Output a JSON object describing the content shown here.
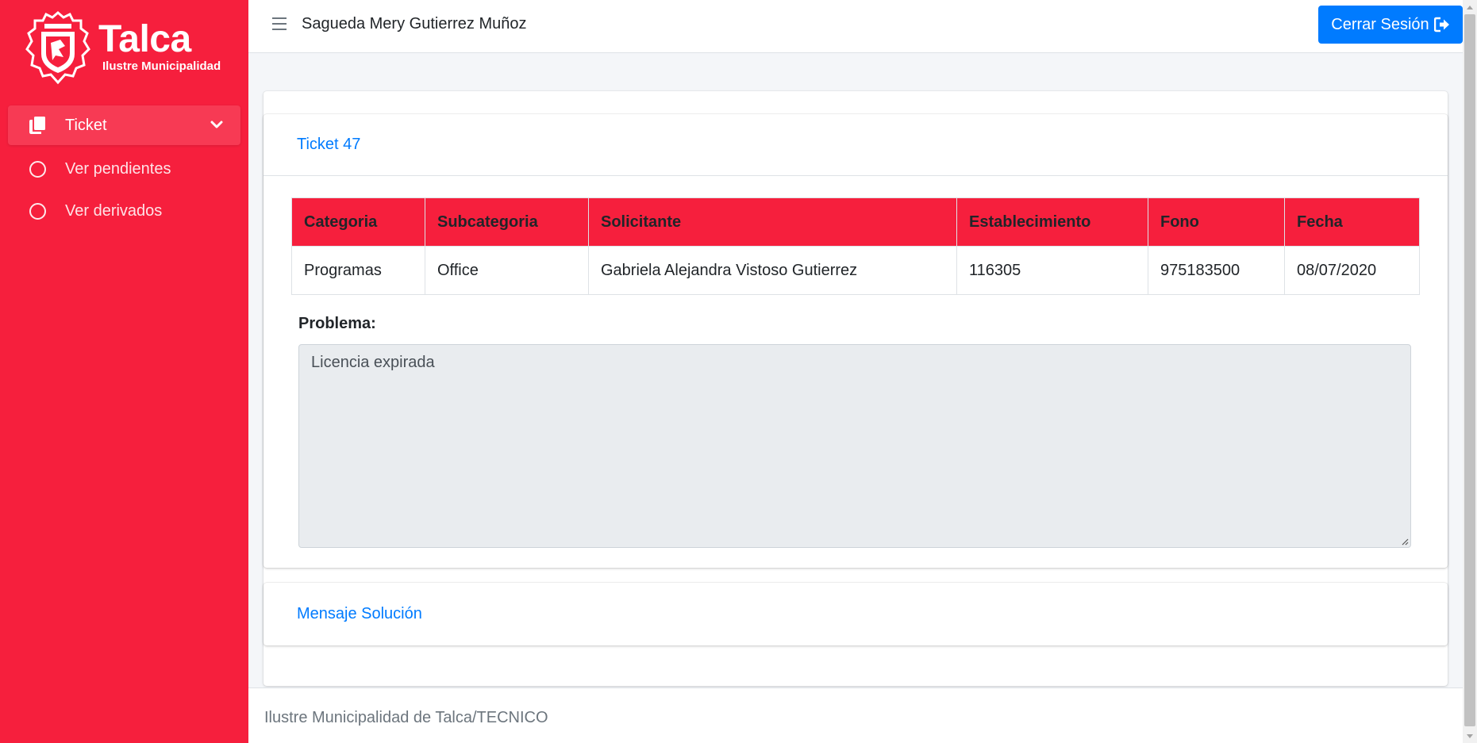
{
  "brand": {
    "name": "Talca",
    "subtitle": "Ilustre Municipalidad"
  },
  "sidebar": {
    "menu": {
      "label": "Ticket",
      "icon": "copy-icon"
    },
    "items": [
      {
        "label": "Ver pendientes",
        "icon": "circle-icon"
      },
      {
        "label": "Ver derivados",
        "icon": "circle-icon"
      }
    ]
  },
  "header": {
    "user_name": "Sagueda Mery Gutierrez Muñoz",
    "logout_label": "Cerrar Sesión"
  },
  "ticket": {
    "title": "Ticket 47",
    "columns": [
      "Categoria",
      "Subcategoria",
      "Solicitante",
      "Establecimiento",
      "Fono",
      "Fecha"
    ],
    "row": [
      "Programas",
      "Office",
      "Gabriela Alejandra Vistoso Gutierrez",
      "116305",
      "975183500",
      "08/07/2020"
    ],
    "problem_label": "Problema:",
    "problem_text": "Licencia expirada"
  },
  "solution": {
    "title": "Mensaje Solución"
  },
  "footer": {
    "text": "Ilustre Municipalidad de Talca/TECNICO"
  },
  "colors": {
    "brand_red": "#f61f3d",
    "primary_blue": "#007bff"
  }
}
